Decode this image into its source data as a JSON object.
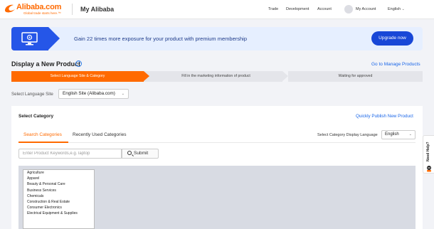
{
  "header": {
    "logo_text": "Alibaba.com",
    "logo_tagline": "Global trade starts here.™",
    "title": "My Alibaba",
    "nav": [
      "Trade",
      "Development",
      "Account"
    ],
    "my_account": "My Account",
    "language": "English"
  },
  "banner": {
    "icon": "monitor-icon",
    "text": "Gain 22 times more exposure for your product with premium membership",
    "button": "Upgrade now"
  },
  "page": {
    "title": "Display a New Product",
    "manage_link": "Go to Manage Products"
  },
  "steps": [
    "Select Language Site & Category",
    "Fill in the marketing information of product",
    "Waiting for approved"
  ],
  "language_site": {
    "label": "Select Language Site",
    "value": "English Site (Alibaba.com)"
  },
  "category": {
    "title": "Select Category",
    "quick_link": "Quickly Publish New Product",
    "tabs": [
      "Search Categories",
      "Recently Used Categories"
    ],
    "display_language_label": "Select Category Display Language",
    "display_language_value": "English",
    "search_placeholder": "Enter Product Keywords,e.g. laptop",
    "submit": "Submit",
    "items": [
      "Agriculture",
      "Apparel",
      "Beauty & Personal Care",
      "Business Services",
      "Chemicals",
      "Construction & Real Estate",
      "Consumer Electronics",
      "Electrical Equipment & Supplies"
    ]
  },
  "help_tab": "Need Help?",
  "colors": {
    "accent": "#ff6a00",
    "primary": "#1847d7",
    "link": "#1a66e8"
  }
}
